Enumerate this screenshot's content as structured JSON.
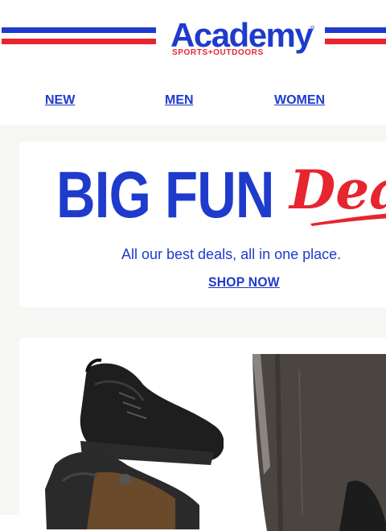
{
  "header": {
    "logo": {
      "wordmark": "Academy",
      "tagline": "SPORTS+OUTDOORS",
      "registered": "®"
    },
    "colors": {
      "brand_blue": "#1f3bcc",
      "brand_red": "#e6252f"
    }
  },
  "nav": {
    "items": [
      {
        "label": "NEW"
      },
      {
        "label": "MEN"
      },
      {
        "label": "WOMEN"
      }
    ]
  },
  "banner": {
    "headline": "BIG FUN",
    "headline_script": "Dea",
    "subtitle": "All our best deals, all in one place.",
    "cta": "SHOP NOW"
  },
  "products": {
    "items": [
      {
        "icon": "sneakers-image"
      },
      {
        "icon": "apparel-image"
      }
    ]
  }
}
